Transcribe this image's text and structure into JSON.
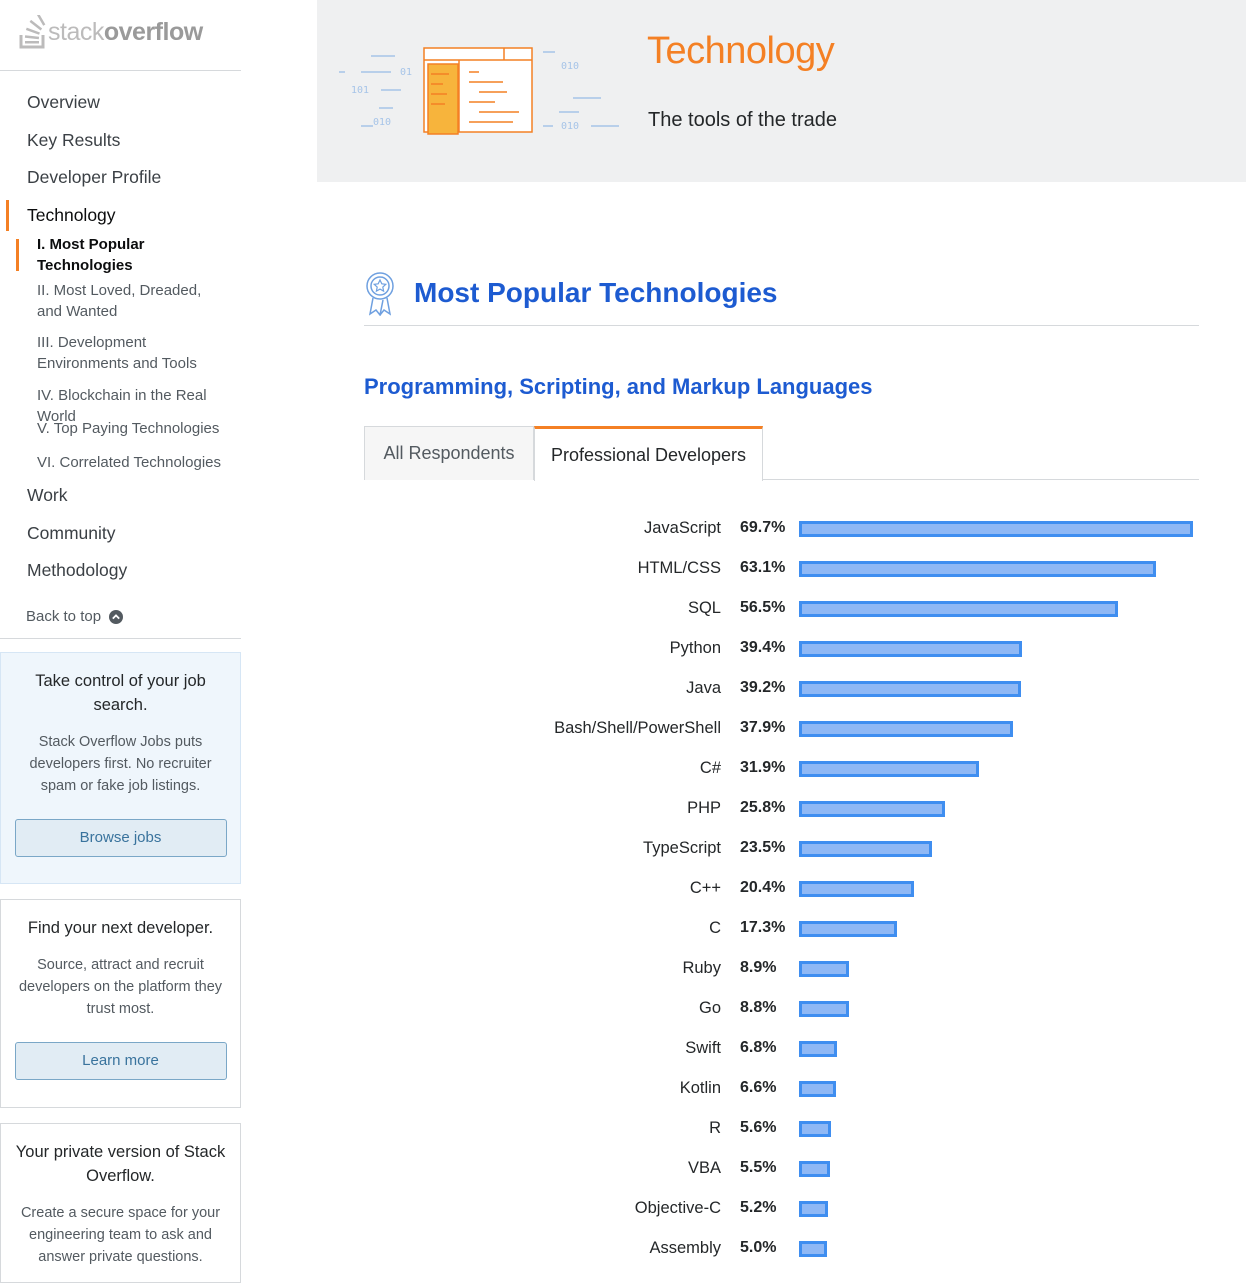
{
  "brand": {
    "name_light": "stack",
    "name_bold": "overflow"
  },
  "sidebar": {
    "nav": [
      {
        "label": "Overview"
      },
      {
        "label": "Key Results"
      },
      {
        "label": "Developer Profile"
      },
      {
        "label": "Technology"
      }
    ],
    "subnav": [
      {
        "label": "I. Most Popular Technologies"
      },
      {
        "label": "II. Most Loved, Dreaded, and Wanted"
      },
      {
        "label": "III. Development Environments and Tools"
      },
      {
        "label": "IV. Blockchain in the Real World"
      },
      {
        "label": "V. Top Paying Technologies"
      },
      {
        "label": "VI. Correlated Technologies"
      }
    ],
    "nav_after": [
      {
        "label": "Work"
      },
      {
        "label": "Community"
      },
      {
        "label": "Methodology"
      }
    ],
    "back_to_top": "Back to top",
    "promos": [
      {
        "title": "Take control of your job search.",
        "body": "Stack Overflow Jobs puts developers first. No recruiter spam or fake job listings.",
        "button": "Browse jobs"
      },
      {
        "title": "Find your next developer.",
        "body": "Source, attract and recruit developers on the platform they trust most.",
        "button": "Learn more"
      },
      {
        "title": "Your private version of Stack Overflow.",
        "body": "Create a secure space for your engineering team to ask and answer private questions."
      }
    ]
  },
  "hero": {
    "title": "Technology",
    "subtitle": "The tools of the trade",
    "illustration_codes": [
      "01",
      "101",
      "010",
      "010",
      "010"
    ]
  },
  "section": {
    "title": "Most Popular Technologies",
    "subtitle": "Programming, Scripting, and Markup Languages",
    "tabs": [
      {
        "label": "All Respondents"
      },
      {
        "label": "Professional Developers"
      }
    ]
  },
  "colors": {
    "accent": "#f48024",
    "link": "#1d5bd1",
    "bar_fill": "#8fb8f5",
    "bar_stroke": "#3f8ef0"
  },
  "chart_data": {
    "type": "bar",
    "orientation": "horizontal",
    "categories": [
      "JavaScript",
      "HTML/CSS",
      "SQL",
      "Python",
      "Java",
      "Bash/Shell/PowerShell",
      "C#",
      "PHP",
      "TypeScript",
      "C++",
      "C",
      "Ruby",
      "Go",
      "Swift",
      "Kotlin",
      "R",
      "VBA",
      "Objective-C",
      "Assembly"
    ],
    "values": [
      69.7,
      63.1,
      56.5,
      39.4,
      39.2,
      37.9,
      31.9,
      25.8,
      23.5,
      20.4,
      17.3,
      8.9,
      8.8,
      6.8,
      6.6,
      5.6,
      5.5,
      5.2,
      5.0
    ],
    "labels": [
      "69.7%",
      "63.1%",
      "56.5%",
      "39.4%",
      "39.2%",
      "37.9%",
      "31.9%",
      "25.8%",
      "23.5%",
      "20.4%",
      "17.3%",
      "8.9%",
      "8.8%",
      "6.8%",
      "6.6%",
      "5.6%",
      "5.5%",
      "5.2%",
      "5.0%"
    ],
    "unit": "%"
  }
}
